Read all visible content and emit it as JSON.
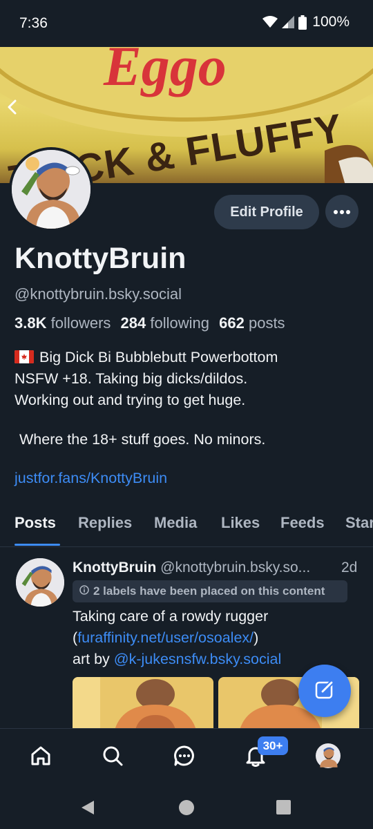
{
  "status_bar": {
    "time": "7:36",
    "battery": "100%",
    "icons": [
      "wifi-icon",
      "signal-icon",
      "battery-icon"
    ]
  },
  "banner": {
    "brand_text": "Eggo",
    "tagline": "THICK & FLUFFY"
  },
  "profile": {
    "display_name": "KnottyBruin",
    "handle": "@knottybruin.bsky.social",
    "followers_count": "3.8K",
    "followers_label": "followers",
    "following_count": "284",
    "following_label": "following",
    "posts_count": "662",
    "posts_label": "posts",
    "edit_button": "Edit Profile",
    "bio": {
      "line1": "Big Dick Bi Bubblebutt Powerbottom",
      "line2": "NSFW +18. Taking big dicks/dildos.",
      "line3": "Working out and trying to get huge.",
      "line4": "Where the 18+ stuff goes. No minors.",
      "link": "justfor.fans/KnottyBruin"
    }
  },
  "tabs": [
    {
      "label": "Posts",
      "active": true
    },
    {
      "label": "Replies",
      "active": false
    },
    {
      "label": "Media",
      "active": false
    },
    {
      "label": "Likes",
      "active": false
    },
    {
      "label": "Feeds",
      "active": false
    },
    {
      "label": "Star",
      "active": false
    }
  ],
  "post": {
    "author_name": "KnottyBruin",
    "author_handle": "@knottybruin.bsky.so...",
    "time": "2d",
    "labels_notice": "2 labels have been placed on this content",
    "text_line1": "Taking care of a rowdy rugger",
    "text_line2_open": "(",
    "text_line2_link": "furaffinity.net/user/osoalex/",
    "text_line2_close": ")",
    "text_line3_prefix": "art by ",
    "text_line3_link": "@k-jukesnsfw.bsky.social"
  },
  "bottom_nav": {
    "items": [
      "home-icon",
      "search-icon",
      "chat-icon",
      "bell-icon",
      "profile-avatar"
    ],
    "notifications_badge": "30+"
  },
  "colors": {
    "background": "#161e27",
    "accent": "#3d8cf5",
    "muted_text": "#aeb6c1",
    "button_bg": "#2e3b4b"
  }
}
